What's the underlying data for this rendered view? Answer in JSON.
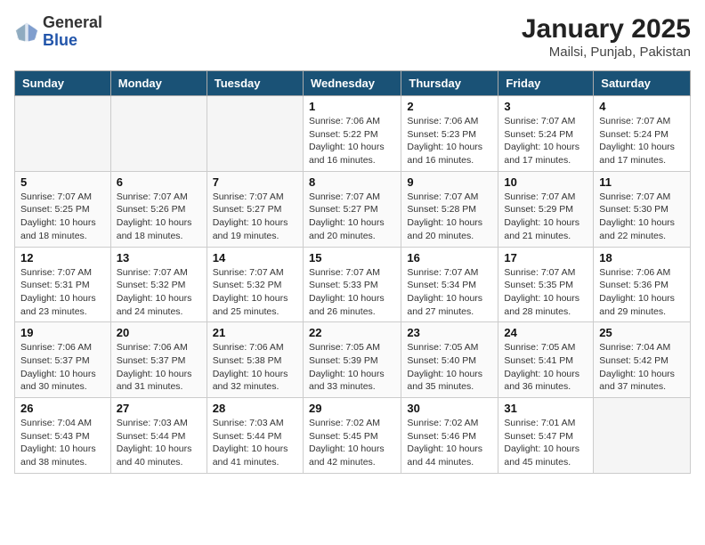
{
  "header": {
    "logo_general": "General",
    "logo_blue": "Blue",
    "month_year": "January 2025",
    "location": "Mailsi, Punjab, Pakistan"
  },
  "days_of_week": [
    "Sunday",
    "Monday",
    "Tuesday",
    "Wednesday",
    "Thursday",
    "Friday",
    "Saturday"
  ],
  "weeks": [
    [
      {
        "day": "",
        "info": ""
      },
      {
        "day": "",
        "info": ""
      },
      {
        "day": "",
        "info": ""
      },
      {
        "day": "1",
        "info": "Sunrise: 7:06 AM\nSunset: 5:22 PM\nDaylight: 10 hours\nand 16 minutes."
      },
      {
        "day": "2",
        "info": "Sunrise: 7:06 AM\nSunset: 5:23 PM\nDaylight: 10 hours\nand 16 minutes."
      },
      {
        "day": "3",
        "info": "Sunrise: 7:07 AM\nSunset: 5:24 PM\nDaylight: 10 hours\nand 17 minutes."
      },
      {
        "day": "4",
        "info": "Sunrise: 7:07 AM\nSunset: 5:24 PM\nDaylight: 10 hours\nand 17 minutes."
      }
    ],
    [
      {
        "day": "5",
        "info": "Sunrise: 7:07 AM\nSunset: 5:25 PM\nDaylight: 10 hours\nand 18 minutes."
      },
      {
        "day": "6",
        "info": "Sunrise: 7:07 AM\nSunset: 5:26 PM\nDaylight: 10 hours\nand 18 minutes."
      },
      {
        "day": "7",
        "info": "Sunrise: 7:07 AM\nSunset: 5:27 PM\nDaylight: 10 hours\nand 19 minutes."
      },
      {
        "day": "8",
        "info": "Sunrise: 7:07 AM\nSunset: 5:27 PM\nDaylight: 10 hours\nand 20 minutes."
      },
      {
        "day": "9",
        "info": "Sunrise: 7:07 AM\nSunset: 5:28 PM\nDaylight: 10 hours\nand 20 minutes."
      },
      {
        "day": "10",
        "info": "Sunrise: 7:07 AM\nSunset: 5:29 PM\nDaylight: 10 hours\nand 21 minutes."
      },
      {
        "day": "11",
        "info": "Sunrise: 7:07 AM\nSunset: 5:30 PM\nDaylight: 10 hours\nand 22 minutes."
      }
    ],
    [
      {
        "day": "12",
        "info": "Sunrise: 7:07 AM\nSunset: 5:31 PM\nDaylight: 10 hours\nand 23 minutes."
      },
      {
        "day": "13",
        "info": "Sunrise: 7:07 AM\nSunset: 5:32 PM\nDaylight: 10 hours\nand 24 minutes."
      },
      {
        "day": "14",
        "info": "Sunrise: 7:07 AM\nSunset: 5:32 PM\nDaylight: 10 hours\nand 25 minutes."
      },
      {
        "day": "15",
        "info": "Sunrise: 7:07 AM\nSunset: 5:33 PM\nDaylight: 10 hours\nand 26 minutes."
      },
      {
        "day": "16",
        "info": "Sunrise: 7:07 AM\nSunset: 5:34 PM\nDaylight: 10 hours\nand 27 minutes."
      },
      {
        "day": "17",
        "info": "Sunrise: 7:07 AM\nSunset: 5:35 PM\nDaylight: 10 hours\nand 28 minutes."
      },
      {
        "day": "18",
        "info": "Sunrise: 7:06 AM\nSunset: 5:36 PM\nDaylight: 10 hours\nand 29 minutes."
      }
    ],
    [
      {
        "day": "19",
        "info": "Sunrise: 7:06 AM\nSunset: 5:37 PM\nDaylight: 10 hours\nand 30 minutes."
      },
      {
        "day": "20",
        "info": "Sunrise: 7:06 AM\nSunset: 5:37 PM\nDaylight: 10 hours\nand 31 minutes."
      },
      {
        "day": "21",
        "info": "Sunrise: 7:06 AM\nSunset: 5:38 PM\nDaylight: 10 hours\nand 32 minutes."
      },
      {
        "day": "22",
        "info": "Sunrise: 7:05 AM\nSunset: 5:39 PM\nDaylight: 10 hours\nand 33 minutes."
      },
      {
        "day": "23",
        "info": "Sunrise: 7:05 AM\nSunset: 5:40 PM\nDaylight: 10 hours\nand 35 minutes."
      },
      {
        "day": "24",
        "info": "Sunrise: 7:05 AM\nSunset: 5:41 PM\nDaylight: 10 hours\nand 36 minutes."
      },
      {
        "day": "25",
        "info": "Sunrise: 7:04 AM\nSunset: 5:42 PM\nDaylight: 10 hours\nand 37 minutes."
      }
    ],
    [
      {
        "day": "26",
        "info": "Sunrise: 7:04 AM\nSunset: 5:43 PM\nDaylight: 10 hours\nand 38 minutes."
      },
      {
        "day": "27",
        "info": "Sunrise: 7:03 AM\nSunset: 5:44 PM\nDaylight: 10 hours\nand 40 minutes."
      },
      {
        "day": "28",
        "info": "Sunrise: 7:03 AM\nSunset: 5:44 PM\nDaylight: 10 hours\nand 41 minutes."
      },
      {
        "day": "29",
        "info": "Sunrise: 7:02 AM\nSunset: 5:45 PM\nDaylight: 10 hours\nand 42 minutes."
      },
      {
        "day": "30",
        "info": "Sunrise: 7:02 AM\nSunset: 5:46 PM\nDaylight: 10 hours\nand 44 minutes."
      },
      {
        "day": "31",
        "info": "Sunrise: 7:01 AM\nSunset: 5:47 PM\nDaylight: 10 hours\nand 45 minutes."
      },
      {
        "day": "",
        "info": ""
      }
    ]
  ]
}
